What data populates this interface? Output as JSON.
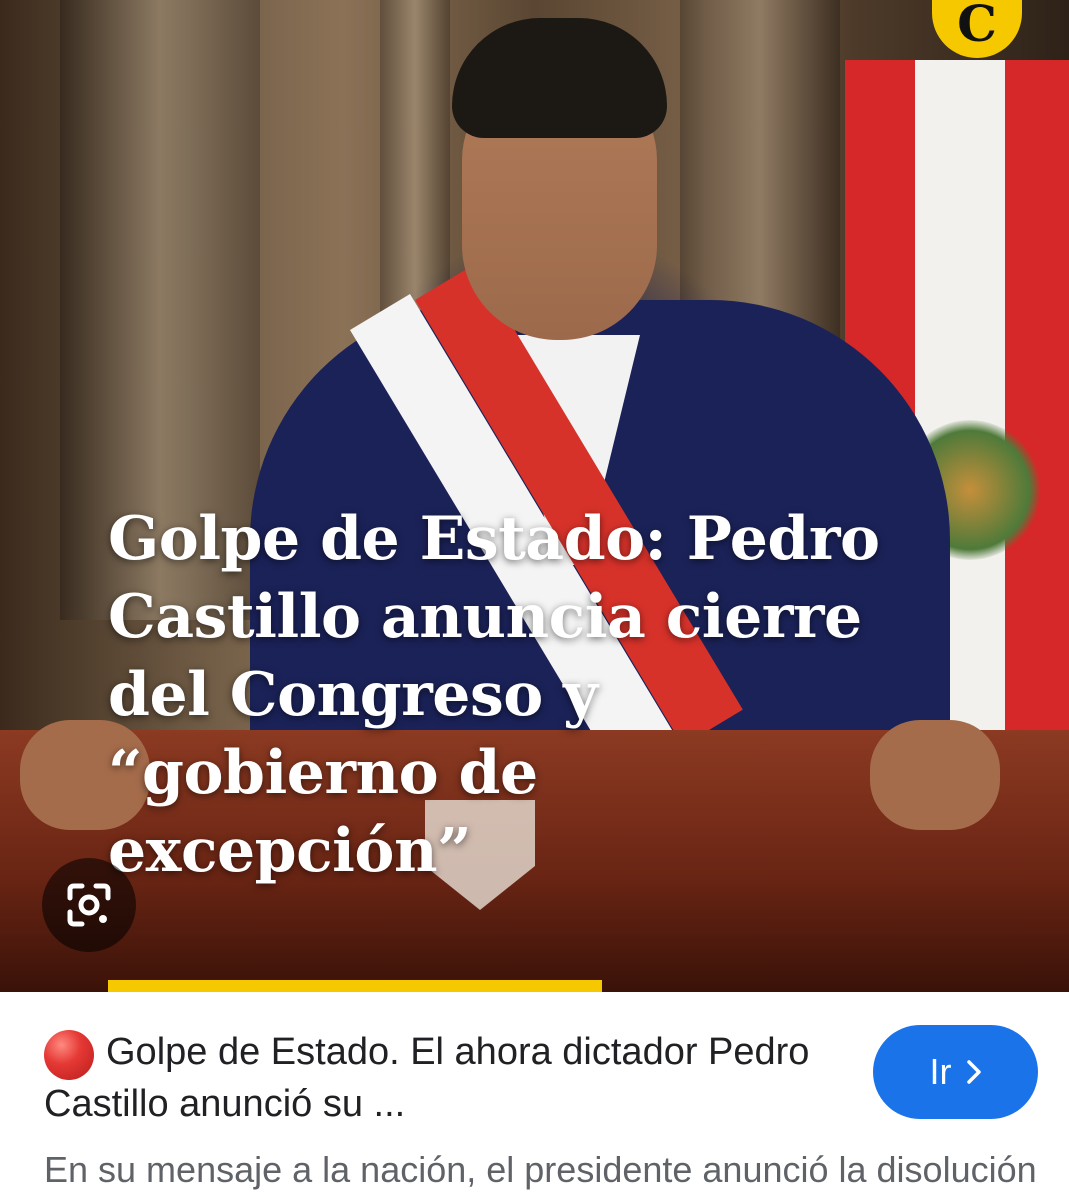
{
  "image": {
    "headline": "Golpe de Estado: Pedro Castillo anuncia cierre del Congreso y “gobierno de excepción”",
    "brand_logo_text": "C",
    "lens_icon": "google-lens-icon"
  },
  "result": {
    "status_icon": "red-circle-icon",
    "title": "Golpe de Estado. El ahora dictador Pedro Castillo anunció su ...",
    "go_button_label": "Ir",
    "go_button_icon": "chevron-right-icon",
    "snippet": "En su mensaje a la nación, el presidente anunció la disolución del Congreso"
  },
  "colors": {
    "accent": "#1a73e8",
    "brand_yellow": "#f5c800",
    "status_red": "#e53935"
  }
}
